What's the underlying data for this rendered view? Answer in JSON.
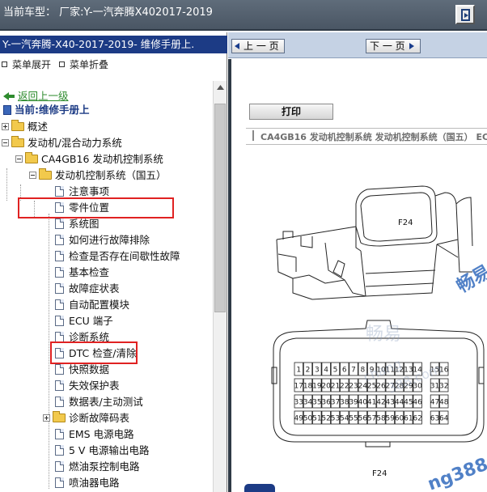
{
  "topbar": {
    "title": "当前车型：  厂家:Y-一汽奔腾X402017-2019"
  },
  "leftpanel": {
    "manual_title": "Y-一汽奔腾-X40-2017-2019- 维修手册上.",
    "expand_all": "菜单展开",
    "collapse_all": "菜单折叠",
    "back_link": "返回上一级",
    "current": "当前:维修手册上",
    "tree": [
      {
        "label": "概述"
      },
      {
        "label": "发动机/混合动力系统"
      },
      {
        "label": "CA4GB16 发动机控制系统"
      },
      {
        "label": "发动机控制系统（国五）"
      },
      {
        "label": "注意事项"
      },
      {
        "label": "零件位置"
      },
      {
        "label": "系统图"
      },
      {
        "label": "如何进行故障排除"
      },
      {
        "label": "检查是否存在间歇性故障"
      },
      {
        "label": "基本检查"
      },
      {
        "label": "故障症状表"
      },
      {
        "label": "自动配置模块"
      },
      {
        "label": "ECU 端子"
      },
      {
        "label": "诊断系统"
      },
      {
        "label": "DTC 检查/清除"
      },
      {
        "label": "快照数据"
      },
      {
        "label": "失效保护表"
      },
      {
        "label": "数据表/主动测试"
      },
      {
        "label": "诊断故障码表"
      },
      {
        "label": "EMS 电源电路"
      },
      {
        "label": "5 V 电源输出电路"
      },
      {
        "label": "燃油泵控制电路"
      },
      {
        "label": "喷油器电路"
      }
    ],
    "highlight_color": "#e02222"
  },
  "rightpanel": {
    "prev_label": "上 一 页",
    "next_label": "下 一 页",
    "print_label": "打印",
    "doc_header": "CA4GB16 发动机控制系统  发动机控制系统（国五）  EC",
    "diagram": {
      "top_connector_label": "F24",
      "bottom_connector_label": "F24",
      "pin_rows": [
        [
          "1",
          "2",
          "3",
          "4",
          "5",
          "6",
          "7",
          "8",
          "9",
          "10",
          "11",
          "12",
          "13",
          "14",
          "15",
          "16"
        ],
        [
          "17",
          "18",
          "19",
          "20",
          "21",
          "22",
          "23",
          "24",
          "25",
          "26",
          "27",
          "28",
          "29",
          "30",
          "31",
          "32"
        ],
        [
          "33",
          "34",
          "35",
          "36",
          "37",
          "38",
          "39",
          "40",
          "41",
          "42",
          "43",
          "44",
          "45",
          "46",
          "47",
          "48"
        ],
        [
          "49",
          "50",
          "51",
          "52",
          "53",
          "54",
          "55",
          "56",
          "57",
          "58",
          "59",
          "60",
          "61",
          "62",
          "63",
          "64"
        ]
      ],
      "watermarks": [
        "畅易",
        "chang",
        "388.com",
        "畅易",
        "ng388."
      ]
    }
  }
}
